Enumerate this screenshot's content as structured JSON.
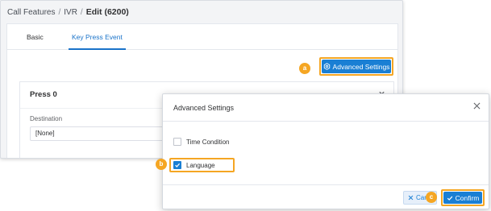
{
  "breadcrumb": {
    "items": [
      "Call Features",
      "IVR"
    ],
    "separator": "/",
    "current": "Edit (6200)"
  },
  "tabs": [
    {
      "label": "Basic",
      "active": false
    },
    {
      "label": "Key Press Event",
      "active": true
    }
  ],
  "toolbar": {
    "advanced_settings_label": "Advanced Settings",
    "advanced_settings_icon": "gear-icon",
    "marker_a": "a"
  },
  "press_card": {
    "title": "Press 0",
    "chevron_icon": "chevron-down-icon",
    "destination_label": "Destination",
    "destination_value": "[None]"
  },
  "dialog": {
    "title": "Advanced Settings",
    "close_icon": "close-icon",
    "options": [
      {
        "label": "Time Condition",
        "checked": false
      },
      {
        "label": "Language",
        "checked": true
      }
    ],
    "marker_b": "b",
    "marker_c": "c",
    "cancel_label": "Cancel",
    "confirm_label": "Confirm"
  },
  "colors": {
    "primary": "#1a7fd4",
    "highlight": "#f5a623",
    "tab_active": "#1a73c9"
  }
}
